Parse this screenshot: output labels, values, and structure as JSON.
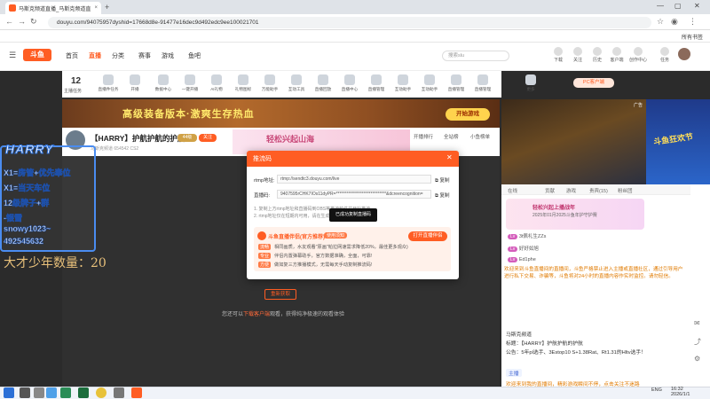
{
  "browser": {
    "tab_title": "马斯克频道直播_马斯克频道直",
    "tab_close": "×",
    "new_tab": "+",
    "url": "douyu.com/94075957dyshid=17668d8e-91477e16dec9d492edc9ee100021701",
    "bookmarks_label": "所有书签",
    "window_controls": [
      "—",
      "▢",
      "✕"
    ]
  },
  "header": {
    "logo": "斗鱼",
    "nav": [
      "首页",
      "直播",
      "分类",
      "赛事",
      "游戏",
      "鱼吧"
    ],
    "active_nav": "直播",
    "search_placeholder": "搜索slu",
    "icons": [
      "下载",
      "关注",
      "历史",
      "客户端",
      "创作中心",
      "任务"
    ]
  },
  "catbar": {
    "level_num": "12",
    "level_label": "主播任务",
    "items": [
      "直播件任务",
      "开播",
      "数据中心",
      "一键开播",
      "AI礼物",
      "礼物图标",
      "万能助手",
      "互动工具",
      "直播回放",
      "直播中心",
      "直播管理",
      "互动助手",
      "更多"
    ],
    "rank_label": "开播排行",
    "pc_label": "PC客户端"
  },
  "banner": {
    "text": "高级装备版本·激爽生存热血",
    "button": "开始游戏"
  },
  "room": {
    "title": "【HARRY】护航护航的护航",
    "meta": "马斯克频道   654542   CS2",
    "level": "44级",
    "follow": "关注",
    "promo": "轻松兴起山海",
    "rank1": "开播排行",
    "rank2": "全站榜",
    "rank3": "小鱼榜单"
  },
  "overlay": {
    "title": "HARRY",
    "rows": [
      "X1=房管+优先奉位",
      "X1=当天车位",
      "12级牌子+群",
      "-银雪",
      "snowy1023~",
      "492545632"
    ],
    "counter": "大才少年数量：20"
  },
  "modal": {
    "title": "推流码",
    "close": "✕",
    "rtmp_label": "rtmp地址:",
    "rtmp_value": "rtmp://sendtc3.douyu.com/live",
    "key_label": "直播码:",
    "key_value": "9407595rCHK7IOs11dyPR=*****************************&dcreencognition=",
    "copy": "复制",
    "tips": [
      "1. 复制上方rtmp地址和直播码到OBS等推流软件并开始推流",
      "2. rtmp地址仅在短期内可用，请在生成后尽快完成推流"
    ],
    "toast": "已成功复制直播码",
    "promo_title": "斗鱼直播伴侣(官方推荐)",
    "promo_tag": "使用须知",
    "promo_button": "打开直播伴侣",
    "promo_rows": [
      {
        "tag": "流畅",
        "text": "相同画质，水友观看\"原画\"帕拉网速需求降低20%，最佳更多观众)"
      },
      {
        "tag": "专业",
        "text": "伴侣内置弹幕助手，官方数据准确，全面，可靠!"
      },
      {
        "tag": "方便",
        "text": "做如复三方推播模式，无需每天手动复制推流码!"
      }
    ]
  },
  "player": {
    "open_button": "重新获取",
    "bottom_text_pre": "您还可以",
    "bottom_link": "下载客户端",
    "bottom_text_post": "观看，获得纯净极速的观看体验"
  },
  "right": {
    "ad_label": "广告",
    "side_text": "斗鱼狂欢节",
    "tabs": [
      "在线",
      "贡献",
      "游戏",
      "贵宾(15)",
      "粉丝团"
    ],
    "gift_title": "轻松兴起上播战年",
    "gift_sub": "2025年01月2025斗鱼年护守护赛",
    "chat": [
      {
        "pill": "Lv",
        "name": "3t佩礼生ZZs",
        "color": "#d45dbb"
      },
      {
        "pill": "Lv",
        "name": "好好如旭",
        "color": "#d45dbb"
      },
      {
        "pill": "Lv",
        "name": "Ed1phe",
        "color": "#d45dbb"
      }
    ],
    "notice": "欢迎来到斗鱼直播间的直播间，斗鱼严格禁止进入主播或直播社区，通过引导用户进行私下交易、诈骗等，斗鱼将对24小时的直播内容作实时监控。请勿轻信。",
    "anchor_name": "马斯克频道",
    "anchor_title_label": "标题：",
    "anchor_title": "【HARRY】护航护航的护航",
    "anchor_desc": "公告：5年pl选手、3Estop10 S+1.38Rat、Rt1.31的Hltv选手！",
    "anchor_tag": "主播",
    "footer_text": "欢迎来到我的直播间，精彩游戏瞬间不停，点击关注不迷路"
  },
  "taskbar": {
    "lang": "ENG",
    "time": "16:32",
    "date": "2026/1/1"
  }
}
